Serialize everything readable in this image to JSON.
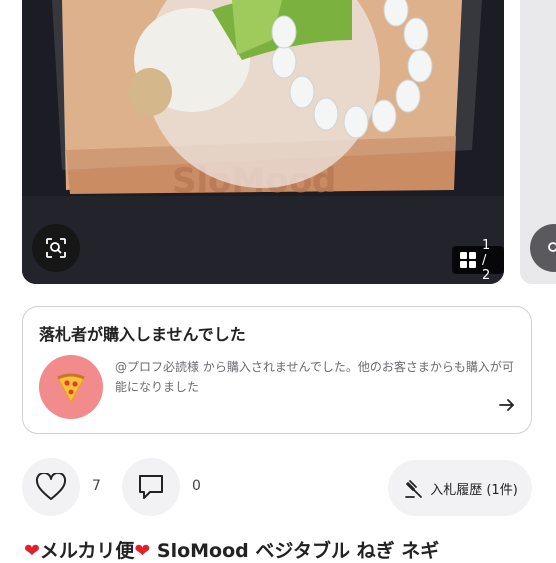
{
  "carousel": {
    "page_indicator": "1 / 2",
    "brand_printed": "SloMood"
  },
  "notice": {
    "title": "落札者が購入しませんでした",
    "body": "@プロフ必読様 から購入されませんでした。他のお客さまからも購入が可能になりました"
  },
  "actions": {
    "like_count": "7",
    "comment_count": "0",
    "bid_history_label": "入札履歴 (1件)"
  },
  "product": {
    "title": "メルカリ便",
    "title_rest": " SloMood ベジタブル ねぎ ネギ"
  },
  "colors": {
    "avatar": "#f28b8b",
    "heart": "#e0202a",
    "chip_bg": "#f2f2f4"
  }
}
